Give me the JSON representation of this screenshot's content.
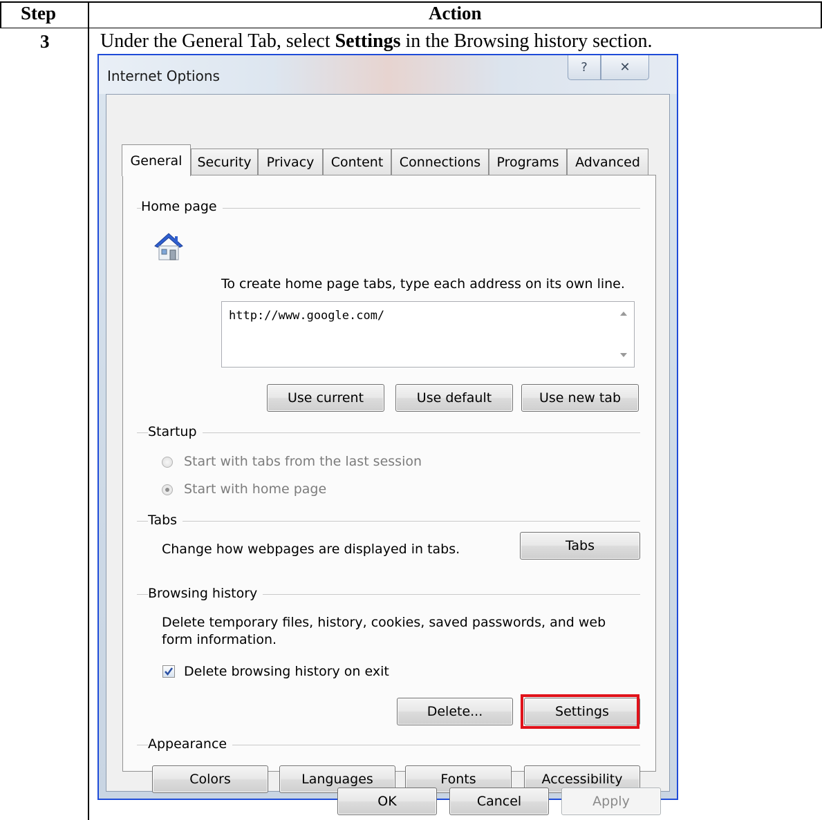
{
  "table": {
    "header_step": "Step",
    "header_action": "Action",
    "step_number": "3",
    "instruction_pre": "Under the General Tab, select ",
    "instruction_bold": "Settings",
    "instruction_post": " in the Browsing history section."
  },
  "window": {
    "title": "Internet Options",
    "help_glyph": "?",
    "close_glyph": "✕"
  },
  "tabs": [
    {
      "label": "General",
      "active": true
    },
    {
      "label": "Security"
    },
    {
      "label": "Privacy"
    },
    {
      "label": "Content"
    },
    {
      "label": "Connections"
    },
    {
      "label": "Programs"
    },
    {
      "label": "Advanced"
    }
  ],
  "home_page": {
    "group_label": "Home page",
    "hint": "To create home page tabs, type each address on its own line.",
    "value": "http://www.google.com/",
    "buttons": {
      "use_current": "Use current",
      "use_default": "Use default",
      "use_new_tab": "Use new tab"
    }
  },
  "startup": {
    "group_label": "Startup",
    "option_last_session": "Start with tabs from the last session",
    "option_home_page": "Start with home page",
    "selected": "Start with home page"
  },
  "tabs_group": {
    "group_label": "Tabs",
    "description": "Change how webpages are displayed in tabs.",
    "button": "Tabs"
  },
  "browsing_history": {
    "group_label": "Browsing history",
    "description_line1": "Delete temporary files, history, cookies, saved passwords, and web",
    "description_line2": "form information.",
    "checkbox_label": "Delete browsing history on exit",
    "checkbox_checked": true,
    "delete_button": "Delete...",
    "settings_button": "Settings",
    "highlight_color": "#e0121a"
  },
  "appearance": {
    "group_label": "Appearance",
    "buttons": {
      "colors": "Colors",
      "languages": "Languages",
      "fonts": "Fonts",
      "accessibility": "Accessibility"
    }
  },
  "footer": {
    "ok": "OK",
    "cancel": "Cancel",
    "apply": "Apply"
  }
}
